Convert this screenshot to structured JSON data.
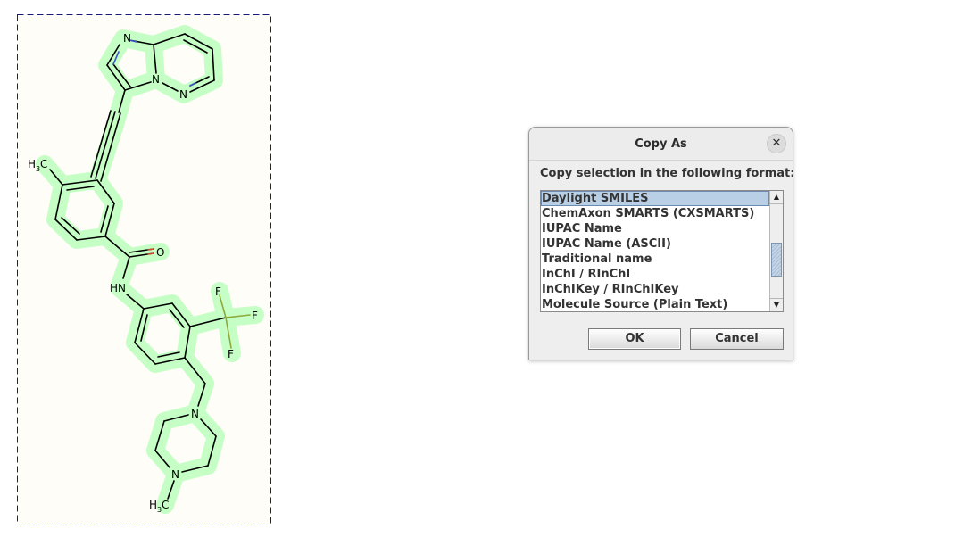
{
  "molecule": {
    "atoms": {
      "n_imidazole": "N",
      "n_bridge": "N",
      "n_pyridazine": "N",
      "methyl_aryl": "H",
      "methyl_aryl_sub": "3",
      "methyl_aryl_c": "C",
      "carbonyl_o": "O",
      "amide_n": "HN",
      "f1": "F",
      "f2": "F",
      "f3": "F",
      "pip_n1": "N",
      "pip_n2": "N",
      "methyl_pip": "H",
      "methyl_pip_sub": "3",
      "methyl_pip_c": "C"
    },
    "colors": {
      "bond": "#000000",
      "highlight": "#c6ffc6",
      "selection_border": "#1a1a7a",
      "n_bond_tint": "#3b55c9",
      "o_bond_tint": "#d44a2a",
      "f_bond_tint": "#8fa93a"
    }
  },
  "dialog": {
    "title": "Copy As",
    "close_icon": "close-icon",
    "prompt": "Copy selection in the following format:",
    "formats": [
      "Daylight SMILES",
      "ChemAxon SMARTS (CXSMARTS)",
      "IUPAC Name",
      "IUPAC Name (ASCII)",
      "Traditional name",
      "InChI / RInChI",
      "InChIKey / RInChIKey",
      "Molecule Source (Plain Text)"
    ],
    "selected_index": 0,
    "ok_label": "OK",
    "cancel_label": "Cancel",
    "scroll_up_icon": "arrow-up-icon",
    "scroll_down_icon": "arrow-down-icon"
  }
}
